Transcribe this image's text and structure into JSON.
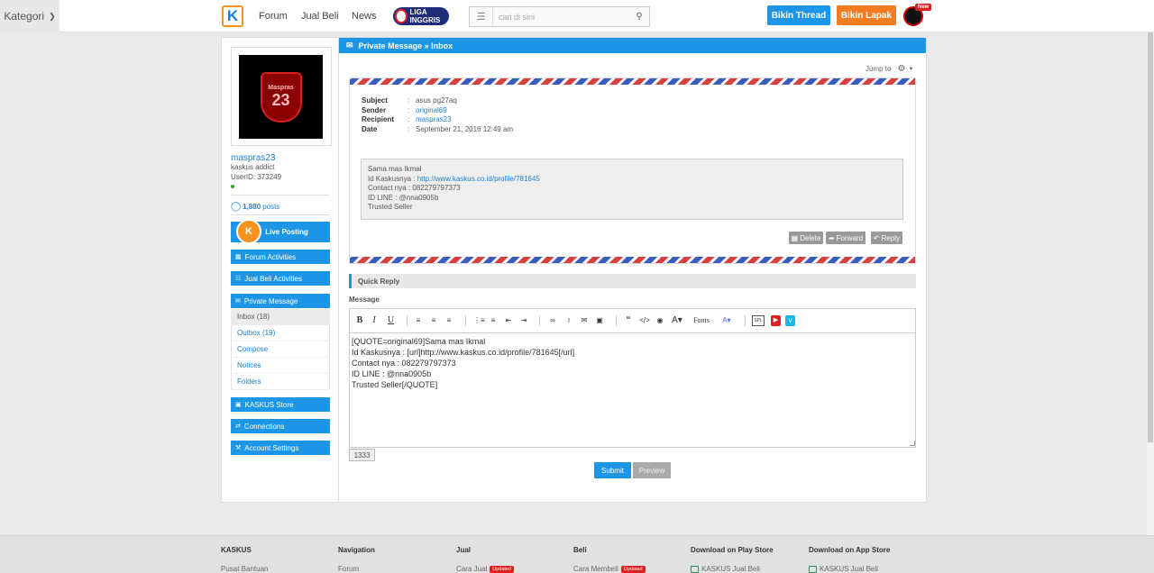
{
  "topnav": {
    "kategori_label": "Kategori",
    "logo_text": "K",
    "links": [
      "Forum",
      "Jual Beli",
      "News"
    ],
    "liga_badge": "LIGA INGGRIS",
    "search_placeholder": "cari di sini",
    "bikin_thread": "Bikin Thread",
    "bikin_lapak": "Bikin Lapak",
    "new_badge": "New"
  },
  "sidebar": {
    "avatar_text_top": "Maspras",
    "avatar_text_num": "23",
    "username": "maspras23",
    "rank": "kaskus addict",
    "userid": "UserID: 373249",
    "posts_count": "1,880",
    "posts_label": "posts",
    "live_posting": "Live Posting",
    "forum_activities": "Forum Activities",
    "jual_beli_activities": "Jual Beli Activities",
    "private_message": "Private Message",
    "submenu": [
      "Inbox (18)",
      "Outbox (19)",
      "Compose",
      "Notices",
      "Folders"
    ],
    "kaskus_store": "KASKUS Store",
    "connections": "Connections",
    "account_settings": "Account Settings"
  },
  "content": {
    "header_title": "Private Message » Inbox",
    "jump_to": "Jump to",
    "meta": {
      "subject_label": "Subject",
      "subject_value": "asus pg27aq",
      "sender_label": "Sender",
      "sender_value": "original69",
      "recipient_label": "Recipient",
      "recipient_value": "maspras23",
      "date_label": "Date",
      "date_value": "September 21, 2016 12:49 am"
    },
    "message": {
      "line1": "Sama mas Ikmal",
      "line2_prefix": "Id Kaskusnya : ",
      "line2_link": "http://www.kaskus.co.id/profile/781645",
      "line3": "Contact nya : 082279797373",
      "line4": "ID LINE : @nna0905b",
      "line5": "Trusted Seller"
    },
    "actions": {
      "delete": "Delete",
      "forward": "Forward",
      "reply": "Reply"
    },
    "quick_reply": "Quick Reply",
    "message_label": "Message",
    "fonts_label": "Fonts",
    "editor_lines": [
      "[QUOTE=original69]Sama mas Ikmal",
      "Id Kaskusnya : [url]http://www.kaskus.co.id/profile/781645[/url]",
      "Contact nya : 082279797373",
      "ID LINE : @nna0905b",
      "Trusted Seller[/QUOTE]"
    ],
    "char_count": "1333",
    "submit": "Submit",
    "preview": "Preview"
  },
  "footer": {
    "columns": [
      {
        "title": "KASKUS",
        "item": "Pusat Bantuan"
      },
      {
        "title": "Navigation",
        "item": "Forum"
      },
      {
        "title": "Jual",
        "item": "Cara Jual",
        "badge": "Updated"
      },
      {
        "title": "Beli",
        "item": "Cara Membeli",
        "badge": "Updated"
      },
      {
        "title": "Download on Play Store",
        "item": "KASKUS Jual Beli"
      },
      {
        "title": "Download on App Store",
        "item": "KASKUS Jual Beli"
      }
    ]
  },
  "colors": {
    "primary": "#1d96e8",
    "orange": "#f47c20",
    "airmail_red": "#d64040",
    "airmail_blue": "#3b5bbf"
  }
}
